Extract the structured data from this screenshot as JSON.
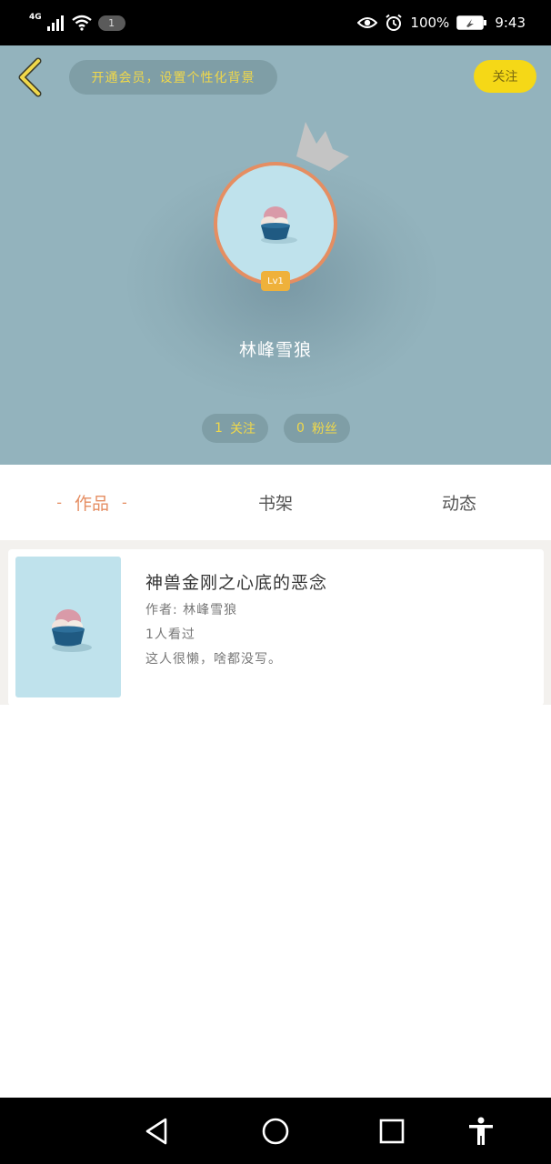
{
  "status_bar": {
    "network": "4G",
    "notification_badge": "1",
    "battery_percent": "100%",
    "time": "9:43",
    "icons": [
      "signal-icon",
      "wifi-icon",
      "eye-icon",
      "alarm-icon",
      "battery-icon"
    ]
  },
  "header": {
    "vip_prompt": "开通会员，设置个性化背景",
    "follow_label": "关注",
    "level_badge": "Lv1",
    "username": "林峰雪狼",
    "stats": {
      "following_count": "1",
      "following_label": "关注",
      "fans_count": "0",
      "fans_label": "粉丝"
    },
    "colors": {
      "background": "#93b3bd",
      "accent_yellow": "#f5d817",
      "avatar_ring": "#e58e62"
    }
  },
  "tabs": [
    {
      "label": "作品",
      "active": true
    },
    {
      "label": "书架",
      "active": false
    },
    {
      "label": "动态",
      "active": false
    }
  ],
  "works": [
    {
      "title": "神兽金刚之心底的恶念",
      "author": "作者: 林峰雪狼",
      "views": "1人看过",
      "description": "这人很懒，啥都没写。"
    }
  ],
  "nav_bar": {
    "icons": [
      "back-triangle-icon",
      "home-circle-icon",
      "recents-square-icon",
      "accessibility-icon"
    ]
  }
}
